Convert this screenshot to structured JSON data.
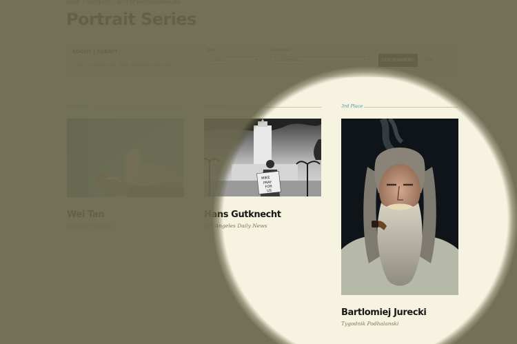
{
  "breadcrumb": {
    "items": [
      "HOME",
      "CONTESTS",
      "BEST OF PHOTOJOURNALISM"
    ],
    "separator": "/"
  },
  "page_title": "Portrait Series",
  "filter_bar": {
    "about_label": "ABOUT",
    "divider": "|",
    "submit_label": "SUBMIT",
    "hint": "Use the filters to find winning entries →",
    "year": {
      "label": "Year",
      "selected": "All Years"
    },
    "category": {
      "label": "Categories",
      "selected": "All Categories"
    },
    "see_winners_label": "SEE WINNERS",
    "reset_label": "Reset"
  },
  "winners": [
    {
      "place": "1st Place",
      "name": "Wei Tan",
      "organization": "SONZON PHOTO"
    },
    {
      "place": "2nd Place",
      "name": "Hans Gutknecht",
      "organization": "Los Angeles Daily News"
    },
    {
      "place": "3rd Place",
      "name": "Bartlomiej Jurecki",
      "organization": "Tygodnik Podhalanski"
    }
  ],
  "photo2_sign": [
    "MIKE",
    "PRAY",
    "FOR",
    "US"
  ],
  "colors": {
    "page_background": "#f7f3e1",
    "dim_overlay": "#68664c",
    "accent_place": "#4b8fa0",
    "button": "#1a1a16",
    "reset": "#c4553a"
  }
}
